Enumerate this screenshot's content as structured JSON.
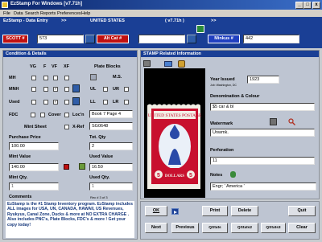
{
  "window": {
    "title": "EzStamp For Windows [v7.71h]",
    "min": "_",
    "max": "□",
    "close": "x"
  },
  "menu": [
    "File",
    "Data",
    "Search",
    "Reports",
    "Preferences",
    "Help"
  ],
  "subheader": {
    "left": "EzStamp - Data Entry",
    "arrows": ">>",
    "country": "UNITED STATES",
    "version": "( v7.71h )"
  },
  "top": {
    "scott_label": "SCOTT #",
    "scott_value": "573",
    "altcat_label": "Alt Cat #",
    "altcat_value": "",
    "minkus_label": "Minkus #",
    "minkus_value": "442"
  },
  "left_panel": {
    "header": "Condition & Details",
    "grades": [
      "VG",
      "F",
      "VF",
      "XF"
    ],
    "plate_blocks_label": "Plate Blocks",
    "rows": [
      {
        "label": "MH"
      },
      {
        "label": "MNH"
      },
      {
        "label": "Used"
      }
    ],
    "ms": "M.S.",
    "ul": "UL",
    "ur": "UR",
    "ll": "LL",
    "lr": "LR",
    "fdc": "FDC",
    "cover": "Cover",
    "locn": "Loc'n",
    "locn_value": "Book 7 Page 4",
    "mint_sheet": "Mint Sheet",
    "xref": "X-Ref",
    "xref_value": "SG0648",
    "purchase_price": "Purchase Price",
    "purchase_value": "100.00",
    "tot_qty": "Tot. Qty",
    "tot_qty_value": "2",
    "mint_value": "Mint Value",
    "mint_value_value": "140.00",
    "used_value": "Used Value",
    "used_value_value": "16.50",
    "mint_qty": "Mint Qty.",
    "mint_qty_value": "1",
    "used_qty": "Used Qty.",
    "used_qty_value": "1",
    "comments_label": "Comments",
    "rec_label": "Rec # 3 of 3",
    "comments": "EzStamp is the #1 Stamp Inventory program. EzStamp includes ALL images for USA, UN, CANADA, HAWAII, US Revenues, Ryukyus, Canal Zone, Ducks & more at NO EXTRA CHARGE . Also includes PNC's, Plate Blocks, FDC's & more ! Get your copy today!"
  },
  "right_panel": {
    "header": "STAMP Related Information",
    "year_label": "Year Issued",
    "year_value": "1923",
    "year_sub": "Job: Washington, DC",
    "denom_label": "Denomination & Colour",
    "denom_value": "$5 car & bl",
    "watermark_label": "Watermark",
    "watermark_value": "Unwmk.",
    "perf_label": "Perforation",
    "perf_value": "11",
    "notes_label": "Notes",
    "notes_value": "Engr; ' America '",
    "stamp_top_text": "UNITED STATES POSTAGE",
    "stamp_value": "5",
    "stamp_bottom_text": "DOLLARS"
  },
  "buttons": {
    "ok": "OK",
    "print": "Print",
    "delete": "Delete",
    "quit": "Quit",
    "next": "Next",
    "previous": "Previous",
    "qstats": "QStats",
    "qstats2": "QStats2",
    "qstats3": "QStats3",
    "clear": "Clear"
  },
  "colors": {
    "brand_blue": "#1a3f95",
    "red_label": "#c01010",
    "stamp_red": "#c8102e"
  }
}
